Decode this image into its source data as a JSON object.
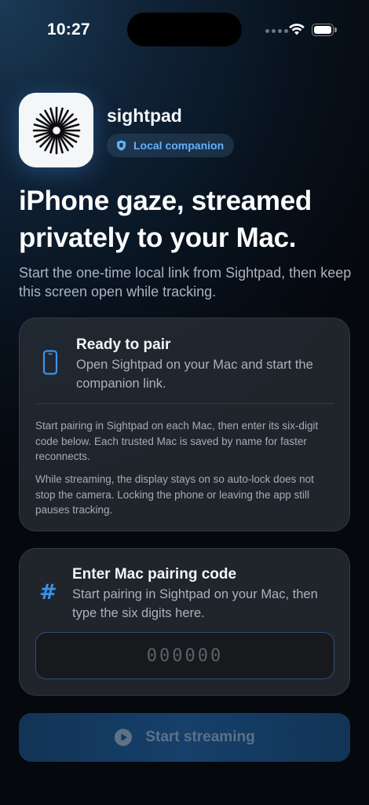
{
  "status_bar": {
    "time": "10:27"
  },
  "app": {
    "name": "sightpad",
    "badge": "Local companion",
    "icon": "starburst-logo-icon"
  },
  "hero": {
    "headline": "iPhone gaze, streamed privately to your Mac.",
    "subtext": "Start the one-time local link from Sightpad, then keep this screen open while tracking."
  },
  "pair_card": {
    "icon": "iphone-icon",
    "title": "Ready to pair",
    "description": "Open Sightpad on your Mac and start the companion link.",
    "note_1": "Start pairing in Sightpad on each Mac, then enter its six-digit code below. Each trusted Mac is saved by name for faster reconnects.",
    "note_2": "While streaming, the display stays on so auto-lock does not stop the camera. Locking the phone or leaving the app still pauses tracking."
  },
  "code_card": {
    "icon": "hash-icon",
    "icon_glyph": "#",
    "title": "Enter Mac pairing code",
    "description": "Start pairing in Sightpad on your Mac, then type the six digits here.",
    "input_value": "",
    "input_placeholder": "000000"
  },
  "start_button": {
    "label": "Start streaming",
    "icon": "play-circle-icon",
    "enabled": false
  },
  "colors": {
    "accent": "#3b92ee",
    "badge_text": "#5fb3ff",
    "button_bg": "#16406a",
    "button_text_disabled": "#5d7188"
  }
}
